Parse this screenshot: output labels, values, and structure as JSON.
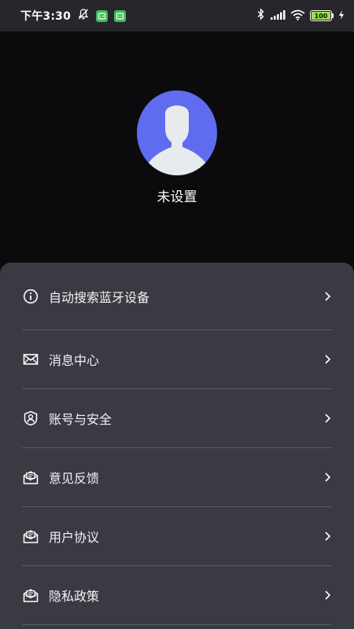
{
  "status_bar": {
    "time": "下午3:30",
    "battery_level": "100",
    "icons": [
      "silent-bell-icon",
      "app-notification-icon",
      "app-notification-icon",
      "bluetooth-icon",
      "signal-icon",
      "wifi-icon",
      "battery-icon",
      "charging-icon"
    ]
  },
  "profile": {
    "avatar_icon": "default-user-avatar-icon",
    "avatar_color": "#5f6cf0",
    "username": "未设置"
  },
  "menu": {
    "items": [
      {
        "label": "自动搜索蓝牙设备",
        "icon": "info-icon"
      },
      {
        "label": "消息中心",
        "icon": "mail-icon"
      },
      {
        "label": "账号与安全",
        "icon": "shield-user-icon"
      },
      {
        "label": "意见反馈",
        "icon": "feedback-mail-icon"
      },
      {
        "label": "用户协议",
        "icon": "agreement-mail-icon"
      },
      {
        "label": "隐私政策",
        "icon": "privacy-mail-icon"
      }
    ]
  },
  "colors": {
    "background": "#0b0b0d",
    "status_bar": "#26262b",
    "panel": "#3a3a43",
    "divider": "#5a5a64",
    "battery": "#9be04a"
  }
}
